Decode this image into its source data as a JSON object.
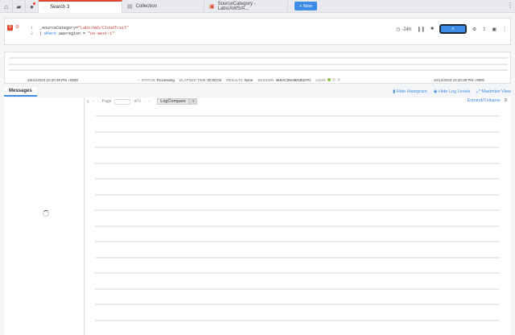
{
  "tabs": [
    {
      "label": "Search 3",
      "active": true
    },
    {
      "label": "Collection",
      "active": false
    },
    {
      "label": "SourceCategory - Labs/AWS/A...",
      "active": false
    }
  ],
  "new_button": "+ New",
  "query": {
    "line1_num": "1",
    "line1_key": "_sourceCategory=",
    "line1_val": "\"Labs/AWS/CloudTrail\"",
    "line2_num": "2",
    "line2_pipe": "| ",
    "line2_kw": "where",
    "line2_rest": " awsregion = ",
    "line2_val": "\"us-west-1\""
  },
  "time_range": "-24h",
  "status": {
    "start_date": "10/11/2023 10:20:39 PM +0900",
    "status_label": "STATUS",
    "status_value": "Processing",
    "elapsed_label": "ELAPSED TIME",
    "elapsed_value": "00:00:02",
    "results_label": "RESULTS",
    "results_value": "None",
    "session_label": "SESSION",
    "session_value": "4E8AC59A9E5B207D",
    "load_label": "LOAD",
    "end_date": "10/12/2023 10:20:39 PM +0900"
  },
  "messages_tab": "Messages",
  "actions": {
    "hide_histogram": "Hide Histogram",
    "hide_log_levels": "Hide Log Levels",
    "maximize_view": "Maximize View"
  },
  "pager": {
    "page_label": "Page",
    "of_label": "of 0"
  },
  "logcompare": "LogCompare",
  "expand_collapse": "Expand/Collapse",
  "colors": {
    "accent": "#3f8ce6",
    "tab_active": "#e2472e"
  }
}
